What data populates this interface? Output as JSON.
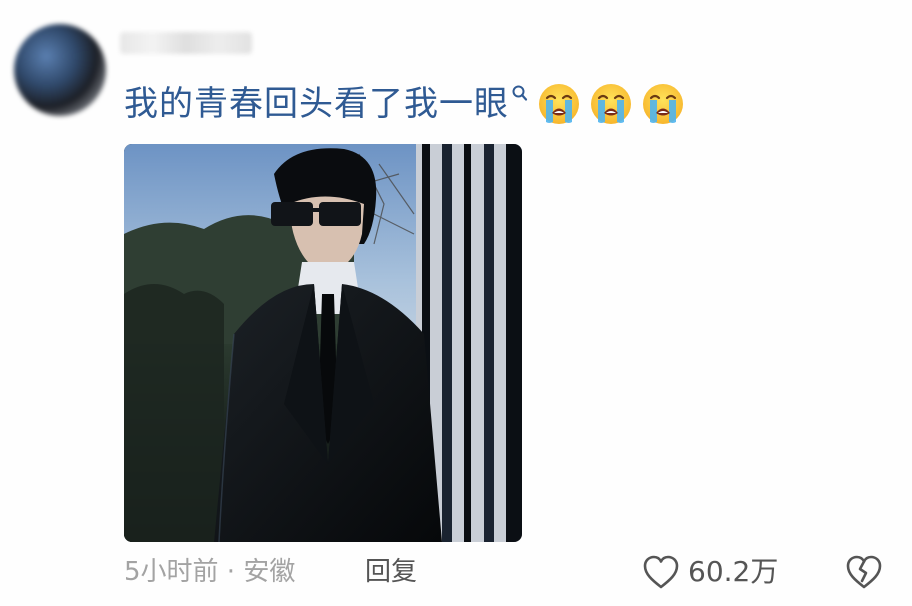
{
  "comment": {
    "text": "我的青春回头看了我一眼",
    "emojis": [
      "crying-face-emoji",
      "crying-face-emoji",
      "crying-face-emoji"
    ]
  },
  "meta": {
    "time_location": "5小时前 · 安徽",
    "reply_label": "回复"
  },
  "actions": {
    "like_count": "60.2万"
  },
  "colors": {
    "comment_text": "#2f5a93",
    "meta_text": "#a3a3a3",
    "action_text": "#555555"
  }
}
